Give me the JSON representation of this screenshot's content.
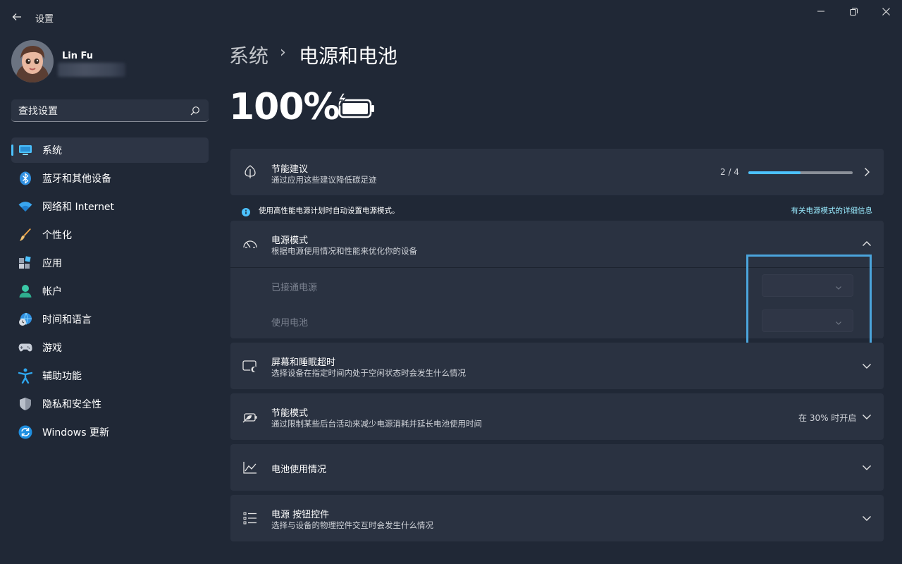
{
  "window": {
    "title": "设置",
    "back_icon": "back-arrow-icon",
    "controls": [
      "minimize-icon",
      "restore-icon",
      "close-icon"
    ]
  },
  "user": {
    "name": "Lin Fu",
    "email": ""
  },
  "search": {
    "placeholder": "查找设置",
    "icon": "search-icon"
  },
  "sidebar": {
    "items": [
      {
        "label": "系统",
        "icon": "system-icon",
        "active": true
      },
      {
        "label": "蓝牙和其他设备",
        "icon": "bluetooth-icon"
      },
      {
        "label": "网络和 Internet",
        "icon": "wifi-icon"
      },
      {
        "label": "个性化",
        "icon": "brush-icon"
      },
      {
        "label": "应用",
        "icon": "apps-icon"
      },
      {
        "label": "帐户",
        "icon": "account-icon"
      },
      {
        "label": "时间和语言",
        "icon": "globe-clock-icon"
      },
      {
        "label": "游戏",
        "icon": "gamepad-icon"
      },
      {
        "label": "辅助功能",
        "icon": "accessibility-icon"
      },
      {
        "label": "隐私和安全性",
        "icon": "shield-icon"
      },
      {
        "label": "Windows 更新",
        "icon": "update-icon"
      }
    ]
  },
  "breadcrumb": {
    "parent": "系统",
    "separator": "›",
    "current": "电源和电池"
  },
  "battery": {
    "percent_text": "100%",
    "icon": "battery-charging-icon"
  },
  "energy_recommendations": {
    "title": "节能建议",
    "subtitle": "通过应用这些建议降低碳足迹",
    "progress_text": "2 / 4",
    "progress_fraction": 0.5,
    "icon": "leaf-icon"
  },
  "info_bar": {
    "text": "使用高性能电源计划时自动设置电源模式。",
    "link": "有关电源模式的详细信息",
    "icon": "info-icon"
  },
  "power_mode": {
    "title": "电源模式",
    "subtitle": "根据电源使用情况和性能来优化你的设备",
    "icon": "gauge-icon",
    "plugged_in_label": "已接通电源",
    "on_battery_label": "使用电池"
  },
  "screen_sleep": {
    "title": "屏幕和睡眠超时",
    "subtitle": "选择设备在指定时间内处于空闲状态时会发生什么情况",
    "icon": "screen-sleep-icon"
  },
  "energy_saver": {
    "title": "节能模式",
    "subtitle": "通过限制某些后台活动来减少电源消耗并延长电池使用时间",
    "status": "在 30% 时开启",
    "icon": "battery-saver-icon"
  },
  "battery_usage": {
    "title": "电池使用情况",
    "icon": "line-chart-icon"
  },
  "power_buttons": {
    "title": "电源 按钮控件",
    "subtitle": "选择与设备的物理控件交互时会发生什么情况",
    "icon": "list-icon"
  },
  "colors": {
    "accent": "#4cc2ff",
    "background": "#202836",
    "card": "#2a3241",
    "highlight_box": "#4ba5dc"
  }
}
